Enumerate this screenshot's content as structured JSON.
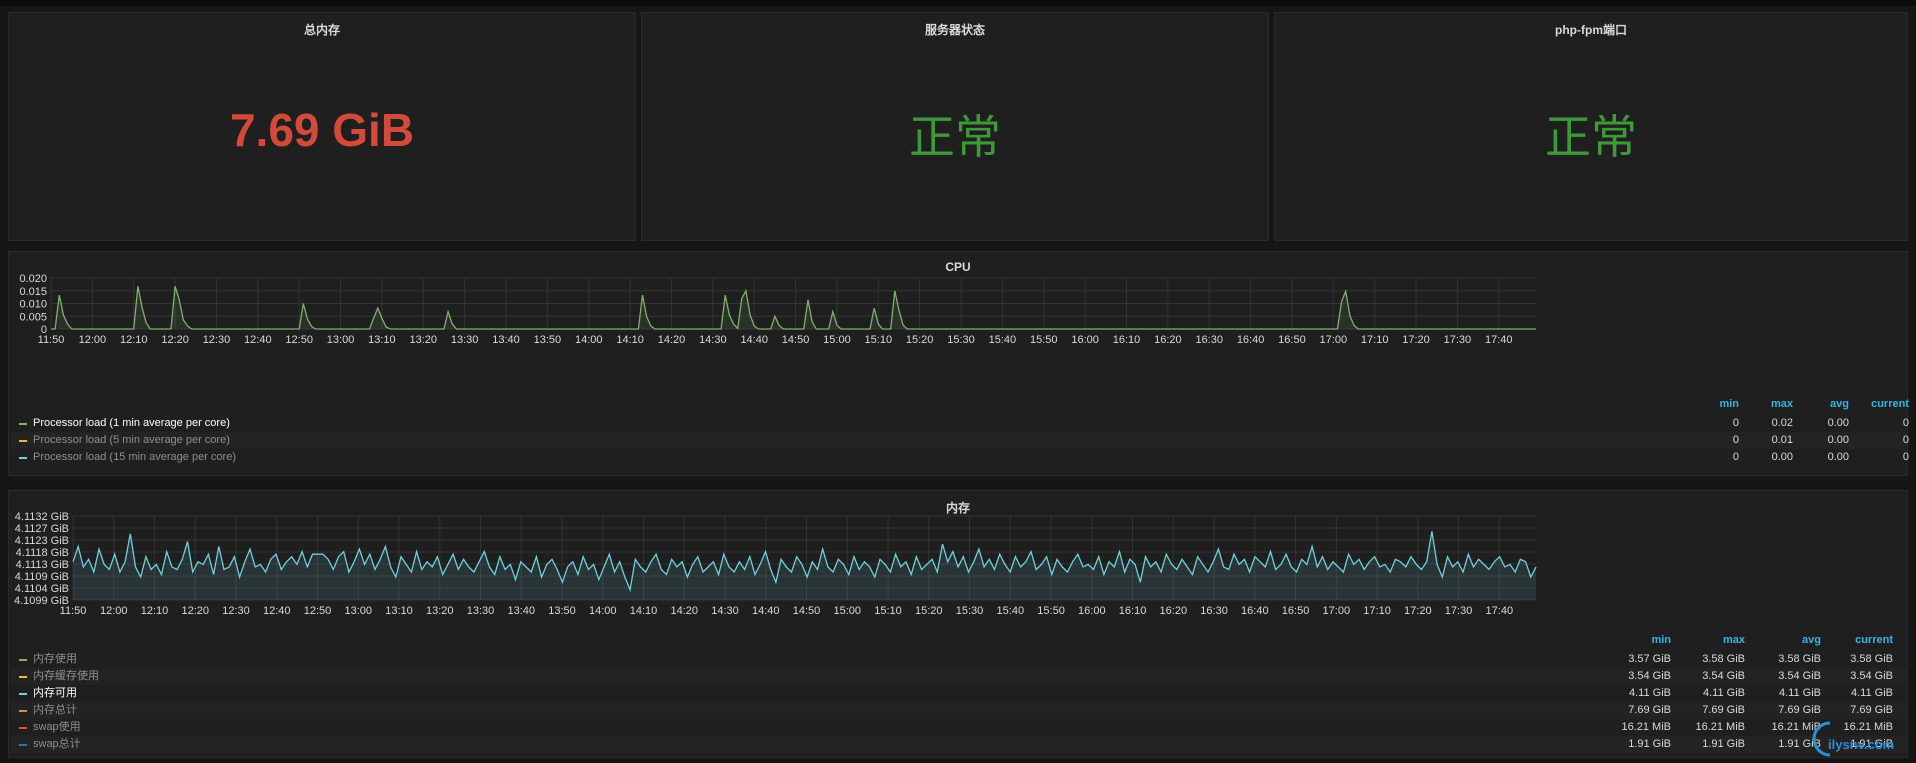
{
  "stats": [
    {
      "title": "总内存",
      "value": "7.69 GiB",
      "color": "#d44a3a"
    },
    {
      "title": "服务器状态",
      "value": "正常",
      "color": "#3d9a36"
    },
    {
      "title": "php-fpm端口",
      "value": "正常",
      "color": "#3d9a36"
    }
  ],
  "colors": {
    "series_green": "#7eb26d",
    "series_yellow": "#eab839",
    "series_blue": "#6ed0e0",
    "series_orange": "#ef843c",
    "series_red": "#e24d42",
    "series_navy": "#1f78c1",
    "legend_header": "#33b5e5",
    "grid": "#333333"
  },
  "cpu_panel": {
    "title": "CPU",
    "legend_headers": [
      "min",
      "max",
      "avg",
      "current"
    ],
    "legend": [
      {
        "name": "Processor load (1 min average per core)",
        "color": "#7eb26d",
        "min": "0",
        "max": "0.02",
        "avg": "0.00",
        "current": "0",
        "highlight": true
      },
      {
        "name": "Processor load (5 min average per core)",
        "color": "#eab839",
        "min": "0",
        "max": "0.01",
        "avg": "0.00",
        "current": "0",
        "highlight": false
      },
      {
        "name": "Processor load (15 min average per core)",
        "color": "#6ed0e0",
        "min": "0",
        "max": "0.00",
        "avg": "0.00",
        "current": "0",
        "highlight": false
      }
    ]
  },
  "mem_panel": {
    "title": "内存",
    "legend_headers": [
      "min",
      "max",
      "avg",
      "current"
    ],
    "legend": [
      {
        "name": "内存使用",
        "color": "#7eb26d",
        "min": "3.57 GiB",
        "max": "3.58 GiB",
        "avg": "3.58 GiB",
        "current": "3.58 GiB",
        "highlight": false
      },
      {
        "name": "内存缓存使用",
        "color": "#eab839",
        "min": "3.54 GiB",
        "max": "3.54 GiB",
        "avg": "3.54 GiB",
        "current": "3.54 GiB",
        "highlight": false
      },
      {
        "name": "内存可用",
        "color": "#6ed0e0",
        "min": "4.11 GiB",
        "max": "4.11 GiB",
        "avg": "4.11 GiB",
        "current": "4.11 GiB",
        "highlight": true
      },
      {
        "name": "内存总计",
        "color": "#ef843c",
        "min": "7.69 GiB",
        "max": "7.69 GiB",
        "avg": "7.69 GiB",
        "current": "7.69 GiB",
        "highlight": false
      },
      {
        "name": "swap使用",
        "color": "#e24d42",
        "min": "16.21 MiB",
        "max": "16.21 MiB",
        "avg": "16.21 MiB",
        "current": "16.21 MiB",
        "highlight": false
      },
      {
        "name": "swap总计",
        "color": "#1f78c1",
        "min": "1.91 GiB",
        "max": "1.91 GiB",
        "avg": "1.91 GiB",
        "current": "1.91 GiB",
        "highlight": false
      }
    ]
  },
  "watermark": "ilysnv.com",
  "chart_data": [
    {
      "type": "line",
      "title": "CPU",
      "x_time_start": "11:50",
      "x_tick_labels": [
        "11:50",
        "12:00",
        "12:10",
        "12:20",
        "12:30",
        "12:40",
        "12:50",
        "13:00",
        "13:10",
        "13:20",
        "13:30",
        "13:40",
        "13:50",
        "14:00",
        "14:10",
        "14:20",
        "14:30",
        "14:40",
        "14:50",
        "15:00",
        "15:10",
        "15:20",
        "15:30",
        "15:40",
        "15:50",
        "16:00",
        "16:10",
        "16:20",
        "16:30",
        "16:40",
        "16:50",
        "17:00",
        "17:10",
        "17:20",
        "17:30",
        "17:40"
      ],
      "y_tick_labels": [
        "0",
        "0.005",
        "0.010",
        "0.015",
        "0.020"
      ],
      "ylim": [
        0,
        0.02
      ],
      "xlim_minutes": [
        0,
        359
      ],
      "grid": true,
      "series": [
        {
          "name": "Processor load (1 min average per core)",
          "color": "#7eb26d",
          "points": [
            [
              0,
              0
            ],
            [
              1,
              0
            ],
            [
              2,
              0.0133
            ],
            [
              3,
              0.0055
            ],
            [
              4,
              0.002
            ],
            [
              5,
              0
            ],
            [
              19,
              0
            ],
            [
              20,
              0
            ],
            [
              21,
              0.0168
            ],
            [
              22,
              0.0085
            ],
            [
              23,
              0.0025
            ],
            [
              24,
              0
            ],
            [
              29,
              0
            ],
            [
              30,
              0.0168
            ],
            [
              31,
              0.0115
            ],
            [
              32,
              0.0035
            ],
            [
              33,
              0.0012
            ],
            [
              34,
              0
            ],
            [
              60,
              0
            ],
            [
              61,
              0.01
            ],
            [
              62,
              0.0038
            ],
            [
              63,
              0.001
            ],
            [
              64,
              0
            ],
            [
              77,
              0
            ],
            [
              78,
              0.0042
            ],
            [
              79,
              0.0082
            ],
            [
              80,
              0.0042
            ],
            [
              81,
              0.0008
            ],
            [
              82,
              0
            ],
            [
              95,
              0
            ],
            [
              96,
              0.0068
            ],
            [
              97,
              0.002
            ],
            [
              98,
              0
            ],
            [
              142,
              0
            ],
            [
              143,
              0.0133
            ],
            [
              144,
              0.0048
            ],
            [
              145,
              0.0012
            ],
            [
              146,
              0
            ],
            [
              162,
              0
            ],
            [
              163,
              0.0133
            ],
            [
              164,
              0.0055
            ],
            [
              165,
              0.002
            ],
            [
              166,
              0.0002
            ],
            [
              167,
              0.012
            ],
            [
              168,
              0.015
            ],
            [
              169,
              0.0055
            ],
            [
              170,
              0.0012
            ],
            [
              171,
              0
            ],
            [
              174,
              0
            ],
            [
              175,
              0.005
            ],
            [
              176,
              0.0015
            ],
            [
              177,
              0
            ],
            [
              182,
              0
            ],
            [
              183,
              0.0115
            ],
            [
              184,
              0.0028
            ],
            [
              185,
              0
            ],
            [
              188,
              0
            ],
            [
              189,
              0.0068
            ],
            [
              190,
              0.0015
            ],
            [
              191,
              0
            ],
            [
              198,
              0
            ],
            [
              199,
              0.0082
            ],
            [
              200,
              0.002
            ],
            [
              201,
              0
            ],
            [
              203,
              0
            ],
            [
              204,
              0.015
            ],
            [
              205,
              0.0072
            ],
            [
              206,
              0.0015
            ],
            [
              207,
              0
            ],
            [
              311,
              0
            ],
            [
              312,
              0.0108
            ],
            [
              313,
              0.0148
            ],
            [
              314,
              0.0052
            ],
            [
              315,
              0.0015
            ],
            [
              316,
              0
            ],
            [
              359,
              0
            ]
          ]
        }
      ]
    },
    {
      "type": "line",
      "title": "内存",
      "x_time_start": "11:50",
      "x_tick_labels": [
        "11:50",
        "12:00",
        "12:10",
        "12:20",
        "12:30",
        "12:40",
        "12:50",
        "13:00",
        "13:10",
        "13:20",
        "13:30",
        "13:40",
        "13:50",
        "14:00",
        "14:10",
        "14:20",
        "14:30",
        "14:40",
        "14:50",
        "15:00",
        "15:10",
        "15:20",
        "15:30",
        "15:40",
        "15:50",
        "16:00",
        "16:10",
        "16:20",
        "16:30",
        "16:40",
        "16:50",
        "17:00",
        "17:10",
        "17:20",
        "17:30",
        "17:40"
      ],
      "y_tick_labels": [
        "4.1099 GiB",
        "4.1104 GiB",
        "4.1109 GiB",
        "4.1113 GiB",
        "4.1118 GiB",
        "4.1123 GiB",
        "4.1127 GiB",
        "4.1132 GiB"
      ],
      "ylim": [
        4.1099,
        4.1132
      ],
      "xlim_minutes": [
        0,
        359
      ],
      "grid": true,
      "series": [
        {
          "name": "内存可用",
          "color": "#6ed0e0",
          "values": [
            4.1114,
            4.112,
            4.1112,
            4.1115,
            4.111,
            4.1119,
            4.1113,
            4.1111,
            4.1117,
            4.111,
            4.1114,
            4.1125,
            4.1112,
            4.1108,
            4.1116,
            4.1111,
            4.1113,
            4.1109,
            4.1118,
            4.1112,
            4.1111,
            4.1115,
            4.1122,
            4.111,
            4.1114,
            4.1113,
            4.1117,
            4.1109,
            4.112,
            4.1111,
            4.1112,
            4.1116,
            4.1108,
            4.1114,
            4.1119,
            4.1112,
            4.1113,
            4.111,
            4.1115,
            4.1117,
            4.1111,
            4.1114,
            4.1116,
            4.1113,
            4.1118,
            4.1112,
            4.1117,
            4.1117,
            4.1117,
            4.1115,
            4.1111,
            4.1116,
            4.1118,
            4.111,
            4.1114,
            4.1119,
            4.1113,
            4.1117,
            4.1111,
            4.1115,
            4.112,
            4.1112,
            4.1108,
            4.1116,
            4.1113,
            4.111,
            4.1118,
            4.1111,
            4.1114,
            4.1112,
            4.1116,
            4.1109,
            4.1113,
            4.1117,
            4.1111,
            4.1115,
            4.1112,
            4.111,
            4.1114,
            4.1118,
            4.1112,
            4.1109,
            4.1116,
            4.1111,
            4.1113,
            4.1107,
            4.1114,
            4.1112,
            4.111,
            4.1116,
            4.1108,
            4.1113,
            4.1115,
            4.1111,
            4.1106,
            4.1112,
            4.1114,
            4.1109,
            4.1116,
            4.1111,
            4.1113,
            4.1107,
            4.1112,
            4.1117,
            4.111,
            4.1114,
            4.1108,
            4.1103,
            4.1115,
            4.1112,
            4.111,
            4.1114,
            4.1117,
            4.1111,
            4.1109,
            4.1115,
            4.1112,
            4.1114,
            4.1108,
            4.1113,
            4.1116,
            4.111,
            4.1112,
            4.1114,
            4.1109,
            4.1117,
            4.1112,
            4.111,
            4.1114,
            4.1111,
            4.1116,
            4.1109,
            4.1113,
            4.1118,
            4.1111,
            4.1106,
            4.1115,
            4.1112,
            4.111,
            4.1116,
            4.1113,
            4.1108,
            4.1114,
            4.1111,
            4.1119,
            4.1112,
            4.111,
            4.1115,
            4.1113,
            4.1109,
            4.1116,
            4.1111,
            4.1114,
            4.1112,
            4.1108,
            4.1115,
            4.1113,
            4.111,
            4.1117,
            4.1112,
            4.1114,
            4.1109,
            4.1116,
            4.1111,
            4.1113,
            4.1115,
            4.111,
            4.1121,
            4.1114,
            4.1118,
            4.1112,
            4.1116,
            4.111,
            4.1114,
            4.1119,
            4.1112,
            4.1115,
            4.1111,
            4.1117,
            4.1113,
            4.111,
            4.1116,
            4.1112,
            4.1114,
            4.1118,
            4.1111,
            4.1113,
            4.1116,
            4.1109,
            4.1115,
            4.1112,
            4.111,
            4.1114,
            4.1117,
            4.1112,
            4.1113,
            4.1111,
            4.1116,
            4.1109,
            4.1114,
            4.1112,
            4.1118,
            4.111,
            4.1115,
            4.1113,
            4.1106,
            4.1116,
            4.1112,
            4.1114,
            4.111,
            4.1117,
            4.1113,
            4.1111,
            4.1115,
            4.1112,
            4.1109,
            4.1116,
            4.1113,
            4.111,
            4.1114,
            4.1119,
            4.1112,
            4.1111,
            4.1117,
            4.1113,
            4.1115,
            4.111,
            4.1116,
            4.1114,
            4.1112,
            4.1118,
            4.1111,
            4.1113,
            4.1117,
            4.1112,
            4.111,
            4.1115,
            4.1113,
            4.112,
            4.1112,
            4.1116,
            4.1111,
            4.1114,
            4.1112,
            4.111,
            4.1117,
            4.1113,
            4.1115,
            4.1111,
            4.1114,
            4.1116,
            4.1112,
            4.1113,
            4.111,
            4.1115,
            4.1114,
            4.1112,
            4.1116,
            4.1113,
            4.1111,
            4.1114,
            4.1126,
            4.1113,
            4.1108,
            4.1116,
            4.1112,
            4.1114,
            4.111,
            4.1117,
            4.1112,
            4.1115,
            4.1113,
            4.1111,
            4.1114,
            4.1116,
            4.1112,
            4.1113,
            4.111,
            4.1115,
            4.1114,
            4.1108,
            4.1112
          ]
        }
      ]
    }
  ]
}
